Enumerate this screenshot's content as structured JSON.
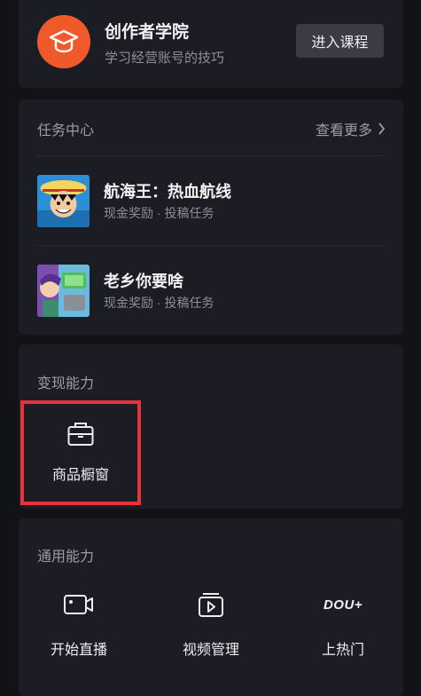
{
  "academy": {
    "title": "创作者学院",
    "subtitle": "学习经营账号的技巧",
    "enter_label": "进入课程"
  },
  "tasks": {
    "title": "任务中心",
    "see_more": "查看更多",
    "items": [
      {
        "name": "航海王：热血航线",
        "meta": "现金奖励 · 投稿任务"
      },
      {
        "name": "老乡你要啥",
        "meta": "现金奖励 · 投稿任务"
      }
    ]
  },
  "monetize": {
    "title": "变现能力",
    "showcase_label": "商品橱窗"
  },
  "general": {
    "title": "通用能力",
    "features": [
      {
        "label": "开始直播",
        "icon": "live-camera-icon"
      },
      {
        "label": "视频管理",
        "icon": "video-manage-icon"
      },
      {
        "label": "上热门",
        "icon": "dou-plus-icon",
        "logo_text": "DOU+"
      }
    ]
  },
  "colors": {
    "background": "#121317",
    "card": "#1c1d24",
    "accent_orange": "#f05a2a",
    "highlight_red": "#e8333b"
  }
}
